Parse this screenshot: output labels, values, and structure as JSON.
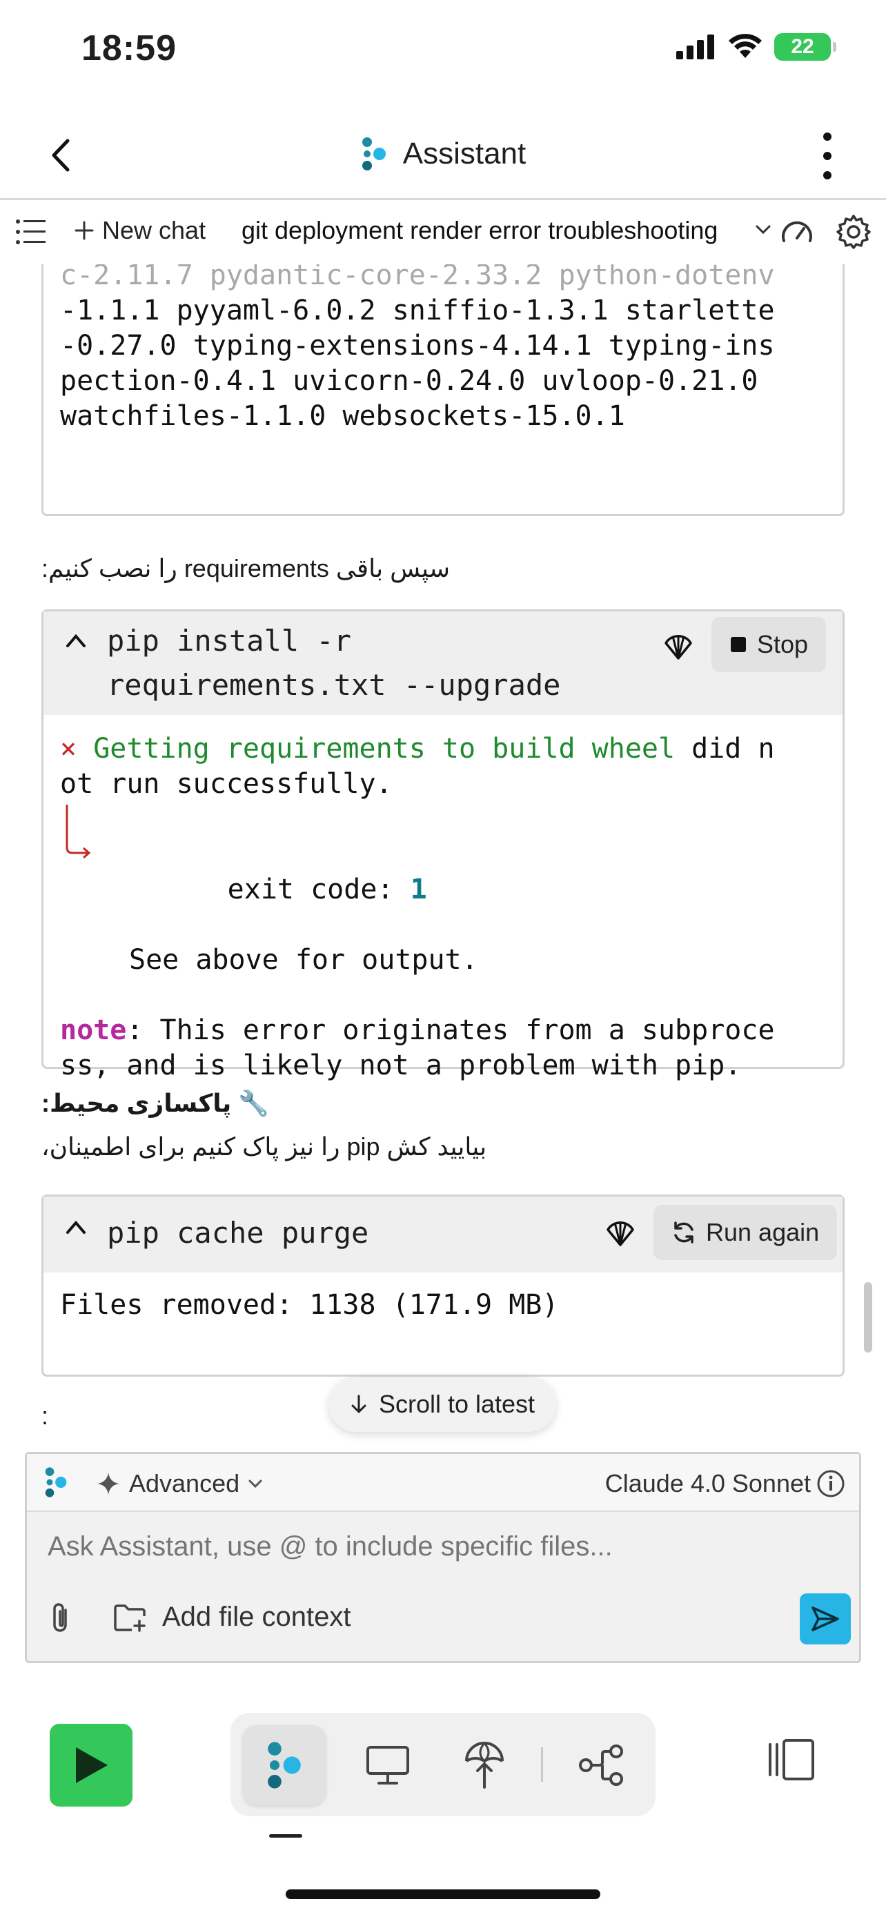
{
  "status": {
    "time": "18:59",
    "battery": "22"
  },
  "header": {
    "title": "Assistant"
  },
  "chat_toolbar": {
    "new_chat": "New chat",
    "title": "git deployment render error troubleshooting"
  },
  "messages": {
    "output1_lines": [
      "c-2.11.7 pydantic-core-2.33.2 python-dotenv",
      "-1.1.1 pyyaml-6.0.2 sniffio-1.3.1 starlette",
      "-0.27.0 typing-extensions-4.14.1 typing-ins",
      "pection-0.4.1 uvicorn-0.24.0 uvloop-0.21.0",
      "watchfiles-1.1.0 websockets-15.0.1"
    ],
    "text1": "سپس باقی requirements را نصب کنیم:",
    "cmd1": {
      "line1": "pip install -r",
      "line2": "requirements.txt --upgrade",
      "button": "Stop"
    },
    "error": {
      "x_mark": "×",
      "green_part": "Getting requirements to build wheel",
      "rest_part": " did n",
      "line2": "ot run successfully.",
      "exit_label": "exit code: ",
      "exit_code": "1",
      "see_above": "See above for output.",
      "note_label": "note",
      "note_rest": ": This error originates from a subproce",
      "note_line2": "ss, and is likely not a problem with pip."
    },
    "heading2": "🔧 پاکسازی محیط:",
    "text2": "بیایید کش pip را نیز پاک کنیم برای اطمینان،",
    "cmd2": {
      "line1": "pip cache purge",
      "button": "Run again",
      "output": "Files removed: 1138 (171.9 MB)"
    },
    "trailing": ":"
  },
  "scroll_to_latest": "Scroll to latest",
  "composer": {
    "mode": "Advanced",
    "model": "Claude 4.0 Sonnet",
    "placeholder": "Ask Assistant, use @ to include specific files...",
    "add_context": "Add file context"
  },
  "colors": {
    "accent": "#27b5e5",
    "run": "#34c759",
    "error_green": "#1f8a2e",
    "note_magenta": "#b4299e"
  },
  "icons": [
    "back-icon",
    "assistant-logo-icon",
    "more-icon",
    "list-icon",
    "plus-icon",
    "chevron-down-icon",
    "speedometer-icon",
    "gear-icon",
    "chevron-up-icon",
    "shell-icon",
    "stop-icon",
    "refresh-icon",
    "arrow-down-icon",
    "sparkle-icon",
    "info-icon",
    "paperclip-icon",
    "folder-add-icon",
    "send-icon",
    "play-icon",
    "monitor-icon",
    "deploy-icon",
    "git-icon",
    "panel-icon"
  ]
}
